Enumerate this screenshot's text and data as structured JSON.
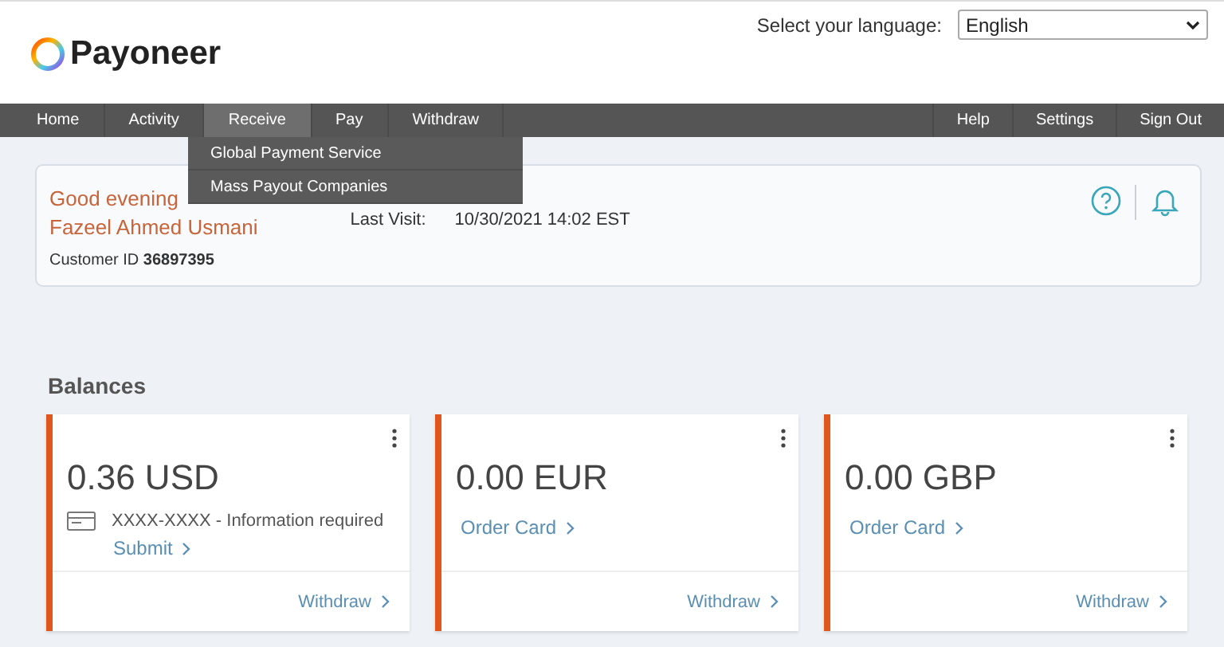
{
  "language": {
    "label": "Select your language:",
    "value": "English"
  },
  "logo": {
    "text": "Payoneer"
  },
  "nav": {
    "left": [
      {
        "label": "Home",
        "selected": false
      },
      {
        "label": "Activity",
        "selected": false
      },
      {
        "label": "Receive",
        "selected": true
      },
      {
        "label": "Pay",
        "selected": false
      },
      {
        "label": "Withdraw",
        "selected": false
      }
    ],
    "right": [
      {
        "label": "Help"
      },
      {
        "label": "Settings"
      },
      {
        "label": "Sign Out"
      }
    ],
    "dropdown": [
      {
        "label": "Global Payment Service"
      },
      {
        "label": "Mass Payout Companies"
      }
    ]
  },
  "welcome": {
    "greeting": "Good evening",
    "name": "Fazeel Ahmed Usmani",
    "customer_id_label": "Customer ID",
    "customer_id": "36897395",
    "last_visit_label": "Last Visit:",
    "last_visit": "10/30/2021 14:02 EST"
  },
  "balances": {
    "title": "Balances",
    "cards": [
      {
        "amount": "0.36 USD",
        "kind": "card_info",
        "info": "XXXX-XXXX - Information required",
        "link": "Submit",
        "action": "Withdraw"
      },
      {
        "amount": "0.00 EUR",
        "kind": "order",
        "link": "Order Card",
        "action": "Withdraw"
      },
      {
        "amount": "0.00 GBP",
        "kind": "order",
        "link": "Order Card",
        "action": "Withdraw"
      }
    ]
  }
}
